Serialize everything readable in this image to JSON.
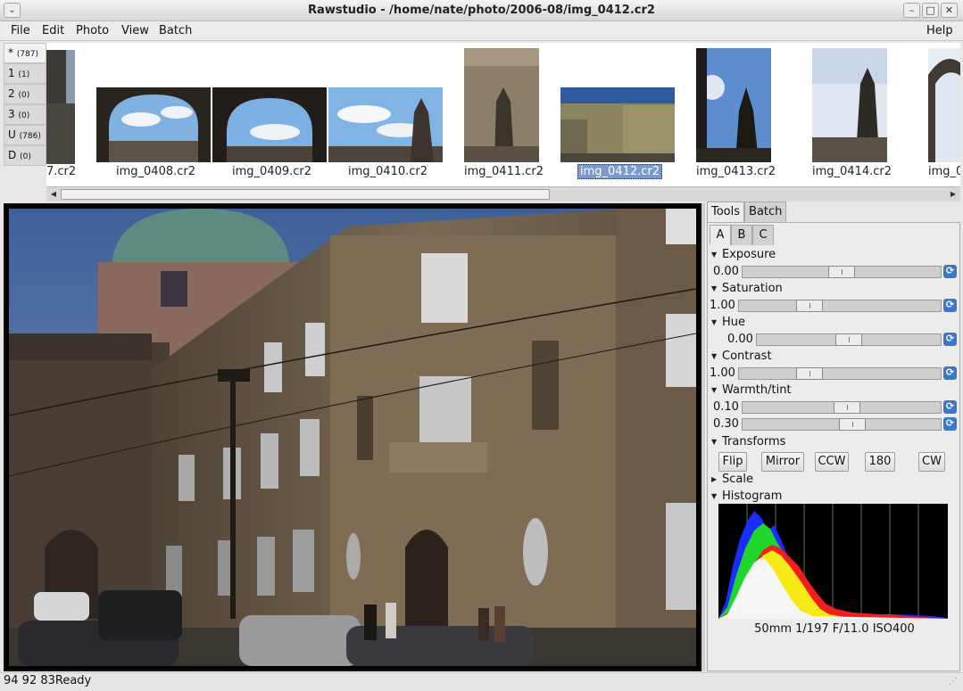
{
  "window": {
    "title": "Rawstudio - /home/nate/photo/2006-08/img_0412.cr2"
  },
  "menubar": {
    "items": [
      "File",
      "Edit",
      "Photo",
      "View",
      "Batch"
    ],
    "help": "Help"
  },
  "filters": [
    {
      "key": "*",
      "count": "(787)"
    },
    {
      "key": "1",
      "count": "(1)"
    },
    {
      "key": "2",
      "count": "(0)"
    },
    {
      "key": "3",
      "count": "(0)"
    },
    {
      "key": "U",
      "count": "(786)"
    },
    {
      "key": "D",
      "count": "(0)"
    }
  ],
  "thumbnails": [
    {
      "name": "7.cr2",
      "selected": false
    },
    {
      "name": "img_0408.cr2",
      "selected": false
    },
    {
      "name": "img_0409.cr2",
      "selected": false
    },
    {
      "name": "img_0410.cr2",
      "selected": false
    },
    {
      "name": "img_0411.cr2",
      "selected": false
    },
    {
      "name": "img_0412.cr2",
      "selected": true
    },
    {
      "name": "img_0413.cr2",
      "selected": false
    },
    {
      "name": "img_0414.cr2",
      "selected": false
    },
    {
      "name": "img_0",
      "selected": false
    }
  ],
  "panel": {
    "tabs": [
      "Tools",
      "Batch"
    ],
    "subtabs": [
      "A",
      "B",
      "C"
    ],
    "exposure": {
      "label": "Exposure",
      "value": "0.00"
    },
    "saturation": {
      "label": "Saturation",
      "value": "1.00"
    },
    "hue": {
      "label": "Hue",
      "value": "0.00"
    },
    "contrast": {
      "label": "Contrast",
      "value": "1.00"
    },
    "warmth": {
      "label": "Warmth/tint",
      "warmth_value": "0.10",
      "tint_value": "0.30"
    },
    "transforms": {
      "label": "Transforms",
      "buttons": [
        "Flip",
        "Mirror",
        "CCW",
        "180",
        "CW"
      ]
    },
    "scale": {
      "label": "Scale"
    },
    "histogram": {
      "label": "Histogram",
      "caption": "50mm 1/197 F/11.0 ISO400"
    }
  },
  "status": {
    "rgb": "94 92 83",
    "message": "Ready"
  },
  "icons": {
    "reset": "reset-icon",
    "expander_open": "triangle-down-icon",
    "expander_closed": "triangle-right-icon"
  }
}
